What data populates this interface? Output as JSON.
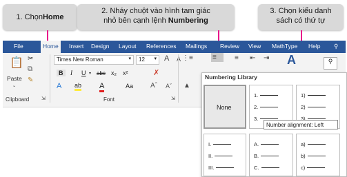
{
  "callouts": {
    "c1_plain": "1. Chọn ",
    "c1_bold": "Home",
    "c2_line1": "2. Nháy chuột vào hình tam giác",
    "c2_line2": "nhỏ bên cạnh lệnh ",
    "c2_bold": "Numbering",
    "c3_line1": "3. Chọn kiểu danh",
    "c3_line2": "sách có thứ tự"
  },
  "colors": {
    "accent": "#e8178a",
    "ribbon_blue": "#2b579a"
  },
  "tabs": [
    "File",
    "Home",
    "Insert",
    "Design",
    "Layout",
    "References",
    "Mailings",
    "Review",
    "View",
    "MathType",
    "Help"
  ],
  "clipboard": {
    "paste_label": "Paste",
    "group_label": "Clipboard"
  },
  "font": {
    "family": "Times New Roman",
    "size": "12",
    "group_label": "Font",
    "bold": "B",
    "italic": "I",
    "underline": "U",
    "strike": "abc",
    "subscript": "x₂",
    "superscript": "x²",
    "aa": "Aa",
    "grow": "A",
    "shrink": "A"
  },
  "numbering_library": {
    "title": "Numbering Library",
    "none_label": "None",
    "col1": [
      "1.",
      "2.",
      "3."
    ],
    "col2": [
      "1)",
      "2)",
      "3)"
    ],
    "roman": [
      "I.",
      "II.",
      "III."
    ],
    "upper": [
      "A.",
      "B.",
      "C."
    ],
    "lower": [
      "a)",
      "b)",
      "c)"
    ],
    "tooltip": "Number alignment: Left"
  }
}
